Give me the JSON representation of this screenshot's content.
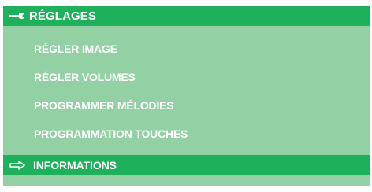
{
  "menu": {
    "title": "RÉGLAGES",
    "title_icon": "wrench-icon",
    "items": [
      {
        "label": "RÉGLER IMAGE"
      },
      {
        "label": "RÉGLER VOLUMES"
      },
      {
        "label": "PROGRAMMER MÉLODIES"
      },
      {
        "label": "PROGRAMMATION TOUCHES"
      }
    ],
    "selected": {
      "label": "INFORMATIONS",
      "icon": "arrow-right-icon"
    }
  },
  "colors": {
    "header": "#1fb05c",
    "panel": "#93d1a4",
    "text": "#ffffff"
  }
}
